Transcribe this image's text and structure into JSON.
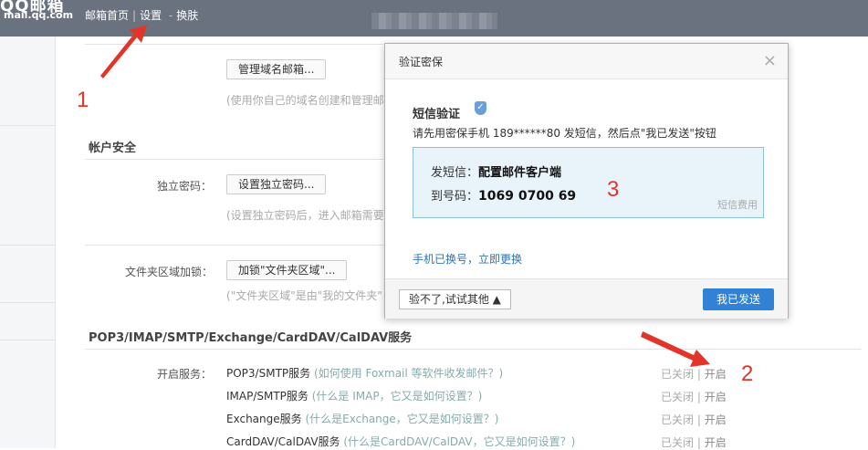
{
  "header": {
    "logo_cn": "QQ邮箱",
    "logo_en": "mail.qq.com",
    "nav_home": "邮箱首页",
    "nav_settings": "设置",
    "nav_dash": "-",
    "nav_skin": "换肤"
  },
  "settings": {
    "domain_button": "管理域名邮箱...",
    "domain_hint": "(使用你自己的域名创建和管理邮",
    "account_security": "帐户安全",
    "independent_pwd_label": "独立密码：",
    "independent_pwd_button": "设置独立密码...",
    "independent_pwd_hint": "(设置独立密码后，进入邮箱需要",
    "folder_lock_label": "文件夹区域加锁：",
    "folder_lock_button": "加锁\"文件夹区域\"...",
    "folder_lock_hint": "(\"文件夹区域\"是由\"我的文件夹\"",
    "pop_section": "POP3/IMAP/SMTP/Exchange/CardDAV/CalDAV服务",
    "enable_label": "开启服务：",
    "services": [
      {
        "name": "POP3/SMTP服务",
        "help": "(如何使用 Foxmail 等软件收发邮件？)",
        "closed": "已关闭",
        "sep": "|",
        "open": "开启"
      },
      {
        "name": "IMAP/SMTP服务",
        "help": "(什么是 IMAP，它又是如何设置？)",
        "closed": "已关闭",
        "sep": "|",
        "open": "开启"
      },
      {
        "name": "Exchange服务",
        "help": "(什么是Exchange，它又是如何设置？)",
        "closed": "已关闭",
        "sep": "|",
        "open": "开启"
      },
      {
        "name": "CardDAV/CalDAV服务",
        "help": "(什么是CardDAV/CalDAV，它又是如何设置？)",
        "closed": "已关闭",
        "sep": "|",
        "open": "开启"
      }
    ]
  },
  "annotations": {
    "n1": "1",
    "n2": "2",
    "n3": "3"
  },
  "dialog": {
    "title": "验证密保",
    "close": "×",
    "sms_title": "短信验证",
    "description": "请先用密保手机 189******80 发短信，然后点\"我已发送\"按钮",
    "send_prefix": "发短信：",
    "send_content": "配置邮件客户端",
    "to_prefix": "到号码：",
    "to_number": "1069 0700 69",
    "fee": "短信费用",
    "change_link": "手机已换号，立即更换",
    "try_other": "验不了,试试其他 ▲",
    "sent_button": "我已发送"
  },
  "colors": {
    "annotation_red": "#e2352a",
    "primary_blue": "#2f82d6",
    "topbar": "#6a7280"
  }
}
